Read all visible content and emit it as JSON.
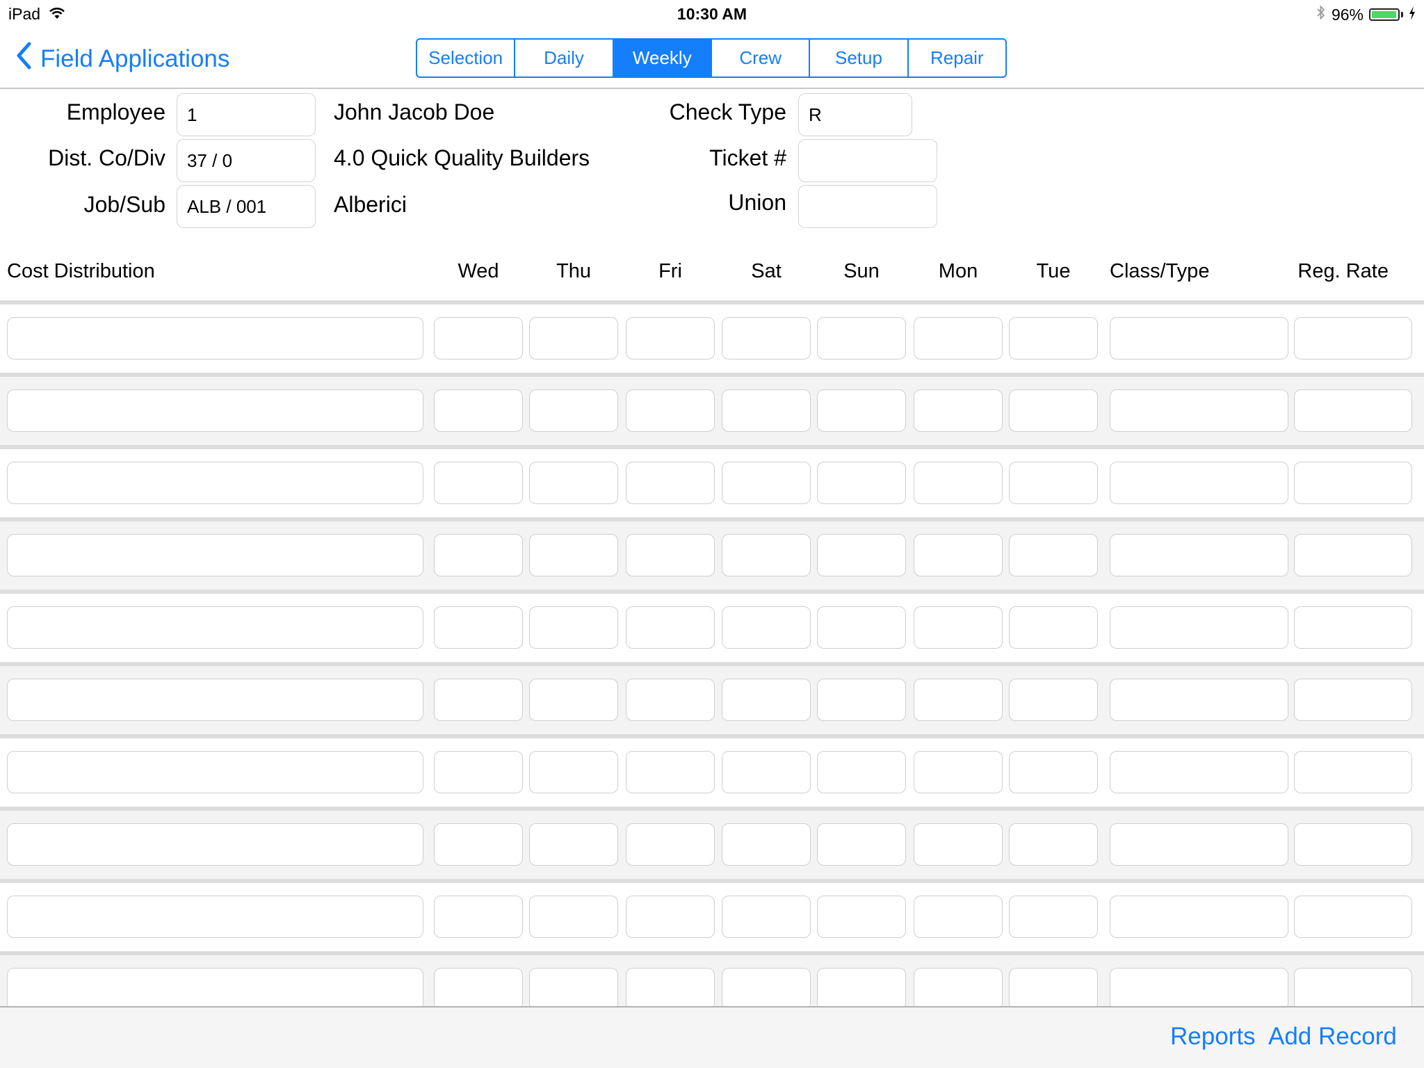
{
  "status_bar": {
    "device": "iPad",
    "time": "10:30 AM",
    "battery_percent": "96%",
    "battery_level": 0.96,
    "icons": [
      "wifi-icon",
      "bluetooth-icon",
      "battery-icon",
      "charging-bolt-icon"
    ],
    "battery_color": "#4cd964"
  },
  "nav": {
    "back_label": "Field Applications",
    "back_icon": "chevron-left-icon",
    "accent_color": "#157efb",
    "tabs": [
      {
        "label": "Selection",
        "active": false
      },
      {
        "label": "Daily",
        "active": false
      },
      {
        "label": "Weekly",
        "active": true
      },
      {
        "label": "Crew",
        "active": false
      },
      {
        "label": "Setup",
        "active": false
      },
      {
        "label": "Repair",
        "active": false
      }
    ]
  },
  "form": {
    "employee": {
      "label": "Employee",
      "value": "1",
      "name": "John Jacob Doe"
    },
    "dist": {
      "label": "Dist. Co/Div",
      "value": "37 / 0",
      "name": "4.0 Quick Quality Builders"
    },
    "job": {
      "label": "Job/Sub",
      "value": "ALB / 001",
      "name": "Alberici"
    },
    "check_type": {
      "label": "Check Type",
      "value": "R"
    },
    "ticket": {
      "label": "Ticket #",
      "value": ""
    },
    "union": {
      "label": "Union",
      "value": ""
    }
  },
  "table": {
    "columns": [
      "Cost Distribution",
      "Wed",
      "Thu",
      "Fri",
      "Sat",
      "Sun",
      "Mon",
      "Tue",
      "Class/Type",
      "Reg. Rate"
    ],
    "rows": [
      [
        "",
        "",
        "",
        "",
        "",
        "",
        "",
        "",
        "",
        ""
      ],
      [
        "",
        "",
        "",
        "",
        "",
        "",
        "",
        "",
        "",
        ""
      ],
      [
        "",
        "",
        "",
        "",
        "",
        "",
        "",
        "",
        "",
        ""
      ],
      [
        "",
        "",
        "",
        "",
        "",
        "",
        "",
        "",
        "",
        ""
      ],
      [
        "",
        "",
        "",
        "",
        "",
        "",
        "",
        "",
        "",
        ""
      ],
      [
        "",
        "",
        "",
        "",
        "",
        "",
        "",
        "",
        "",
        ""
      ],
      [
        "",
        "",
        "",
        "",
        "",
        "",
        "",
        "",
        "",
        ""
      ],
      [
        "",
        "",
        "",
        "",
        "",
        "",
        "",
        "",
        "",
        ""
      ],
      [
        "",
        "",
        "",
        "",
        "",
        "",
        "",
        "",
        "",
        ""
      ],
      [
        "",
        "",
        "",
        "",
        "",
        "",
        "",
        "",
        "",
        ""
      ]
    ]
  },
  "toolbar": {
    "reports_label": "Reports",
    "add_record_label": "Add Record"
  }
}
